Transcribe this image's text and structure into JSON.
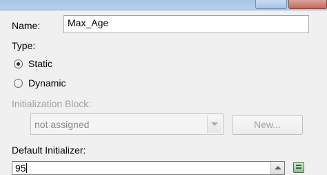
{
  "form": {
    "name_label": "Name:",
    "name_value": "Max_Age",
    "type_label": "Type:",
    "type_options": [
      {
        "label": "Static",
        "checked": true
      },
      {
        "label": "Dynamic",
        "checked": false
      }
    ],
    "init_block_label": "Initialization Block:",
    "init_block_selected": "not assigned",
    "new_button_label": "New...",
    "default_initializer_label": "Default Initializer:",
    "default_initializer_value": "95"
  },
  "icons": {
    "combo_arrow": "chevron-down-icon",
    "scroll_up": "scroll-up-icon",
    "editor": "expression-editor-icon"
  }
}
